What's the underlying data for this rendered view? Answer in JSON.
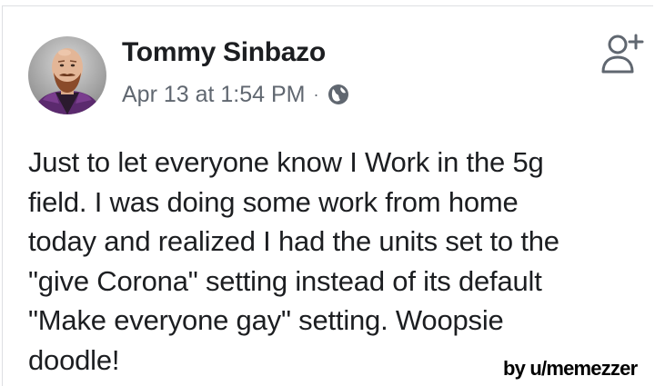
{
  "post": {
    "author_name": "Tommy Sinbazo",
    "timestamp": "Apr 13 at 1:54 PM",
    "separator": "·",
    "privacy_icon": "globe-icon",
    "action_icon": "add-friend-icon",
    "avatar_icon": "user-avatar",
    "text_lines": [
      "Just to let everyone know I Work in the 5g",
      "field. I was doing some work from home",
      "today and realized I had the units set to the",
      "\"give Corona\" setting instead of its default",
      "\"Make everyone gay\" setting. Woopsie",
      "doodle!"
    ]
  },
  "watermark": {
    "text": "by u/memezzer"
  },
  "colors": {
    "text": "#1c1e21",
    "meta": "#606770",
    "border": "#dddfe2",
    "background": "#ffffff"
  }
}
